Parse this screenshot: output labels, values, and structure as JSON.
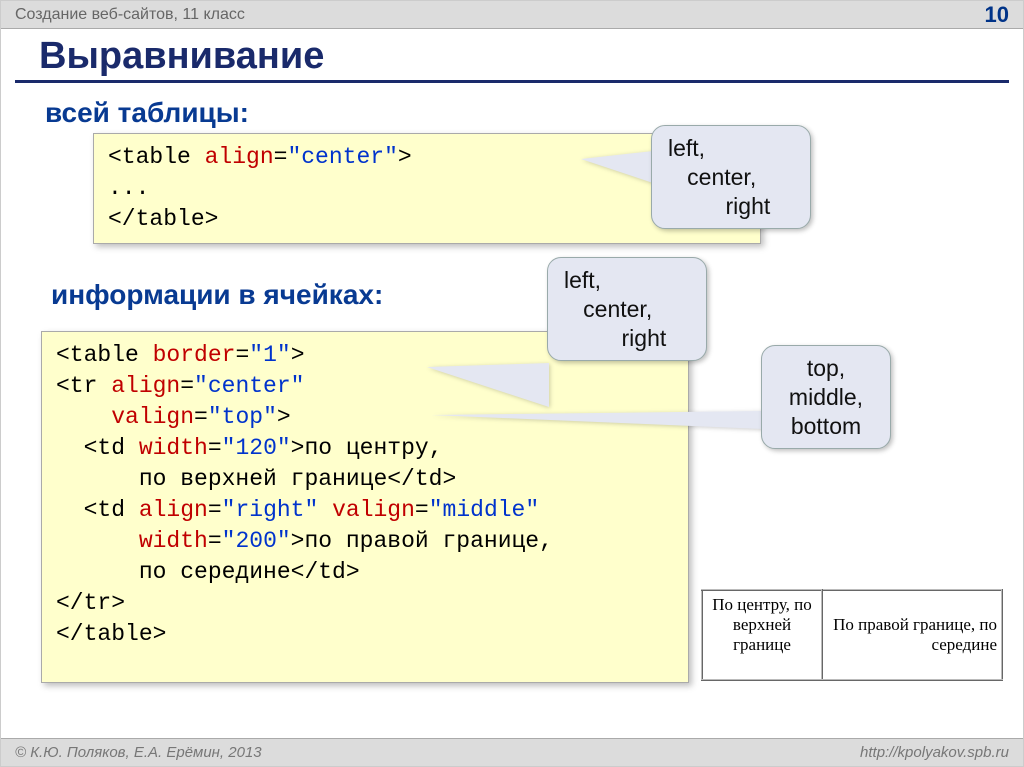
{
  "header": {
    "course": "Создание веб-сайтов, 11 класс",
    "page": "10"
  },
  "title": "Выравнивание",
  "sections": {
    "sub1": "всей таблицы:",
    "sub2": "информации в ячейках:"
  },
  "code1": {
    "l1a": "<table ",
    "l1b": "align",
    "l1c": "=",
    "l1d": "\"center\"",
    "l1e": ">",
    "l2": "...",
    "l3": "</table>"
  },
  "code2": {
    "l1a": "<table ",
    "l1b": "border",
    "l1c": "=",
    "l1d": "\"1\"",
    "l1e": ">",
    "l2a": "<tr ",
    "l2b": "align",
    "l2c": "=",
    "l2d": "\"center\"",
    "l3a": "    ",
    "l3b": "valign",
    "l3c": "=",
    "l3d": "\"top\"",
    "l3e": ">",
    "l4a": "  <td ",
    "l4b": "width",
    "l4c": "=",
    "l4d": "\"120\"",
    "l4e": ">по центру,",
    "l5": "      по верхней границе</td>",
    "l6a": "  <td ",
    "l6b": "align",
    "l6c": "=",
    "l6d": "\"right\"",
    "l6sp": " ",
    "l6e": "valign",
    "l6f": "=",
    "l6g": "\"middle\"",
    "l7a": "      ",
    "l7b": "width",
    "l7c": "=",
    "l7d": "\"200\"",
    "l7e": ">по правой границе,",
    "l8": "      по середине</td>",
    "l9": "</tr>",
    "l10": "</table>"
  },
  "callouts": {
    "c1": {
      "a": "left,",
      "b": "   center,",
      "c": "         right"
    },
    "c2": {
      "a": "left,",
      "b": "   center,",
      "c": "         right"
    },
    "c3": {
      "a": "top,",
      "b": "middle,",
      "c": "bottom"
    }
  },
  "example": {
    "cell1": "По центру, по верхней границе",
    "cell2": "По правой границе, по середине"
  },
  "footer": {
    "left": "© К.Ю. Поляков, Е.А. Ерёмин, 2013",
    "right": "http://kpolyakov.spb.ru"
  }
}
